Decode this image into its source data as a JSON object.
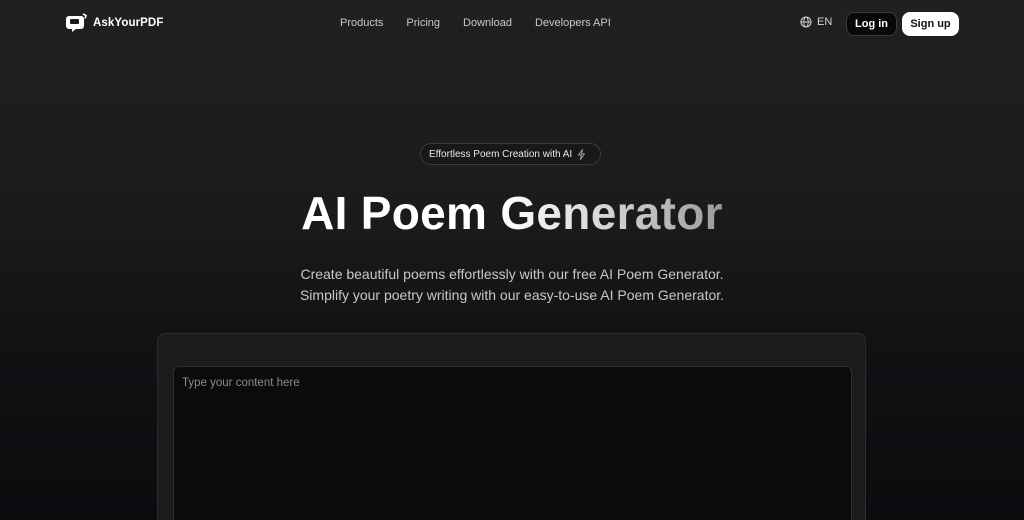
{
  "header": {
    "logo_text": "AskYourPDF",
    "nav": [
      {
        "label": "Products"
      },
      {
        "label": "Pricing"
      },
      {
        "label": "Download"
      },
      {
        "label": "Developers API"
      }
    ],
    "language": "EN",
    "login_label": "Log in",
    "signup_label": "Sign up"
  },
  "hero": {
    "badge": "Effortless Poem Creation with AI",
    "title_part1": "AI Poem ",
    "title_part2": "Generator",
    "subtitle_line1": "Create beautiful poems effortlessly with our free AI Poem Generator.",
    "subtitle_line2": "Simplify your poetry writing with our easy-to-use AI Poem Generator."
  },
  "input": {
    "placeholder": "Type your content here",
    "value": ""
  },
  "icons": {
    "logo": "askyourpdf-logo-icon",
    "language": "globe-icon",
    "badge": "lightning-bolt-icon"
  },
  "colors": {
    "background": "#0e0e11",
    "signup_bg": "#ffffff",
    "login_bg": "#09090b"
  }
}
